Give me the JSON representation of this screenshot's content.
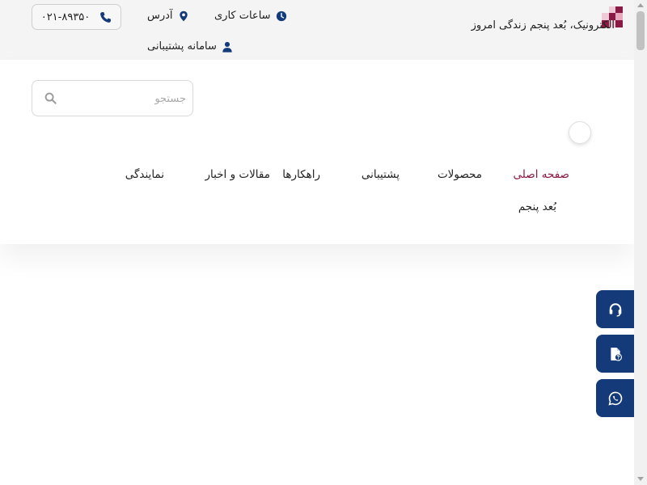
{
  "topbar": {
    "tagline": "الکترونیک، بُعد پنجم زندگی امروز",
    "working_hours": "ساعات کاری",
    "address": "آدرس",
    "support_system": "سامانه پشتیبانی",
    "phone": "۰۲۱-۸۹۳۵۰"
  },
  "search": {
    "placeholder": "جستجو"
  },
  "nav": {
    "items": [
      "صفحه اصلی",
      "محصولات",
      "پشتیبانی",
      "راهکارها",
      "مقالات و اخبار",
      "نمایندگی",
      "بُعد پنجم"
    ],
    "active_index": 0
  },
  "floating": [
    "headset-icon",
    "file-question-icon",
    "whatsapp-icon"
  ],
  "colors": {
    "brand_primary": "#143a7a",
    "brand_accent": "#8a1a45"
  }
}
